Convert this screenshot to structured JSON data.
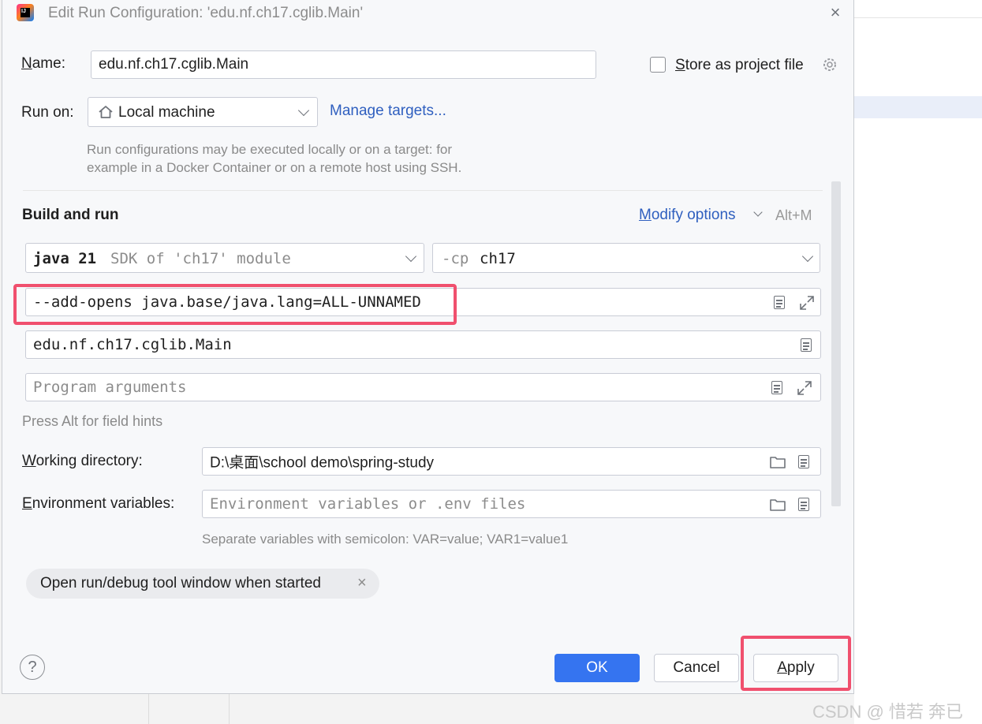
{
  "window": {
    "title": "Edit Run Configuration: 'edu.nf.ch17.cglib.Main'",
    "close_icon": "×"
  },
  "name_row": {
    "label_first": "N",
    "label_rest": "ame:",
    "value": "edu.nf.ch17.cglib.Main",
    "store_label_first": "S",
    "store_label_rest": "tore as project file",
    "store_checked": false
  },
  "run_on": {
    "label": "Run on:",
    "selected": "Local machine",
    "manage_link": "Manage targets...",
    "hint_line1": "Run configurations may be executed locally or on a target: for",
    "hint_line2": "example in a Docker Container or on a remote host using SSH."
  },
  "build_and_run": {
    "heading": "Build and run",
    "modify_first": "M",
    "modify_rest": "odify options",
    "modify_shortcut": "Alt+M",
    "sdk_bold": "java 21",
    "sdk_rest": "SDK of 'ch17' module",
    "cp_prefix": "-cp",
    "cp_value": "ch17",
    "vm_options": "--add-opens java.base/java.lang=ALL-UNNAMED",
    "main_class": "edu.nf.ch17.cglib.Main",
    "program_args_placeholder": "Program arguments",
    "alt_hint": "Press Alt for field hints"
  },
  "working_dir": {
    "label_first": "W",
    "label_rest": "orking directory:",
    "value": "D:\\桌面\\school demo\\spring-study"
  },
  "env_vars": {
    "label_first": "E",
    "label_rest": "nvironment variables:",
    "placeholder": "Environment variables or .env files",
    "hint": "Separate variables with semicolon: VAR=value; VAR1=value1"
  },
  "tag": {
    "label": "Open run/debug tool window when started",
    "remove": "×"
  },
  "buttons": {
    "help": "?",
    "ok": "OK",
    "cancel": "Cancel",
    "apply_first": "A",
    "apply_rest": "pply"
  },
  "watermark": "CSDN @ 惜若 奔已",
  "colors": {
    "accent": "#3574f0",
    "link": "#2f5fbf",
    "highlight_box": "#f0506e"
  }
}
